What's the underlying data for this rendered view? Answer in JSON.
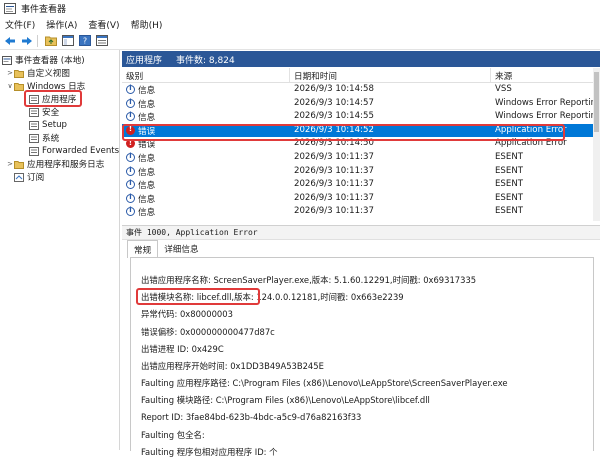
{
  "window": {
    "title": "事件查看器"
  },
  "menu": [
    "文件(F)",
    "操作(A)",
    "查看(V)",
    "帮助(H)"
  ],
  "tree": {
    "root": "事件查看器 (本地)",
    "custom_views": "自定义视图",
    "windows_logs": "Windows 日志",
    "logs": [
      "应用程序",
      "安全",
      "Setup",
      "系统",
      "Forwarded Events"
    ],
    "app_service_logs": "应用程序和服务日志",
    "subscriptions": "订阅"
  },
  "content_header": {
    "title": "应用程序",
    "count": "事件数: 8,824"
  },
  "table": {
    "columns": [
      "级别",
      "日期和时间",
      "来源"
    ],
    "rows": [
      {
        "level": "信息",
        "type": "info",
        "datetime": "2026/9/3 10:14:58",
        "source": "VSS",
        "selected": false
      },
      {
        "level": "信息",
        "type": "info",
        "datetime": "2026/9/3 10:14:57",
        "source": "Windows Error Reporting",
        "selected": false
      },
      {
        "level": "信息",
        "type": "info",
        "datetime": "2026/9/3 10:14:55",
        "source": "Windows Error Reporting",
        "selected": false
      },
      {
        "level": "错误",
        "type": "error",
        "datetime": "2026/9/3 10:14:52",
        "source": "Application Error",
        "selected": true
      },
      {
        "level": "错误",
        "type": "error",
        "datetime": "2026/9/3 10:14:50",
        "source": "Application Error",
        "selected": false
      },
      {
        "level": "信息",
        "type": "info",
        "datetime": "2026/9/3 10:11:37",
        "source": "ESENT",
        "selected": false
      },
      {
        "level": "信息",
        "type": "info",
        "datetime": "2026/9/3 10:11:37",
        "source": "ESENT",
        "selected": false
      },
      {
        "level": "信息",
        "type": "info",
        "datetime": "2026/9/3 10:11:37",
        "source": "ESENT",
        "selected": false
      },
      {
        "level": "信息",
        "type": "info",
        "datetime": "2026/9/3 10:11:37",
        "source": "ESENT",
        "selected": false
      },
      {
        "level": "信息",
        "type": "info",
        "datetime": "2026/9/3 10:11:37",
        "source": "ESENT",
        "selected": false
      }
    ]
  },
  "detail": {
    "header": "事件 1000, Application Error",
    "tabs": [
      "常规",
      "详细信息"
    ],
    "lines": [
      "出错应用程序名称:  ScreenSaverPlayer.exe,版本: 5.1.60.12291,时间戳: 0x69317335",
      "出错模块名称:  libcef.dll,版本: 124.0.0.12181,时间戳: 0x663e2239",
      "异常代码: 0x80000003",
      "错误偏移: 0x000000000477d87c",
      "出错进程 ID: 0x429C",
      "出错应用程序开始时间: 0x1DD3B49A53B245E",
      "Faulting 应用程序路径: C:\\Program Files (x86)\\Lenovo\\LeAppStore\\ScreenSaverPlayer.exe",
      "Faulting 模块路径: C:\\Program Files (x86)\\Lenovo\\LeAppStore\\libcef.dll",
      "Report ID: 3fae84bd-623b-4bdc-a5c9-d76a82163f33",
      "Faulting 包全名:",
      "Faulting 程序包相对应用程序 ID:  个"
    ]
  },
  "colors": {
    "header_blue": "#2b5797",
    "selection": "#0078d7",
    "highlight": "#e03a3a",
    "error": "#d02020",
    "info": "#2a5aa8"
  }
}
